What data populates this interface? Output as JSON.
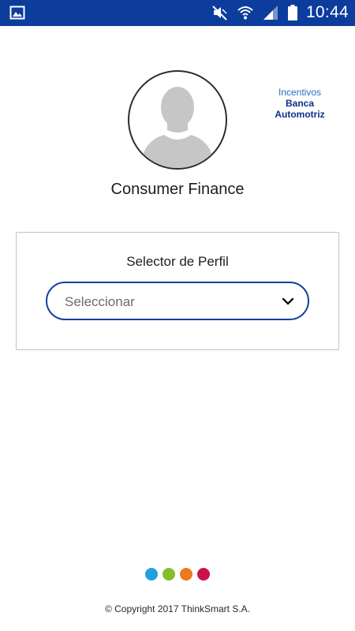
{
  "status_bar": {
    "time": "10:44",
    "icons": [
      "gallery-icon",
      "mute-icon",
      "wifi-icon",
      "signal-icon",
      "battery-icon"
    ],
    "background": "#0c3c9c"
  },
  "brand": {
    "line1": "Incentivos",
    "line2": "Banca",
    "line3": "Automotriz"
  },
  "profile": {
    "name": "Consumer Finance",
    "avatar_icon": "user-silhouette-icon"
  },
  "selector": {
    "title": "Selector de Perfil",
    "value": "Seleccionar",
    "icon": "chevron-down-icon",
    "border_color": "#123fa0"
  },
  "footer": {
    "dot_colors": [
      "#1ea1dc",
      "#86bd2f",
      "#e77a22",
      "#c8144a"
    ],
    "copyright": "© Copyright 2017 ThinkSmart S.A."
  }
}
